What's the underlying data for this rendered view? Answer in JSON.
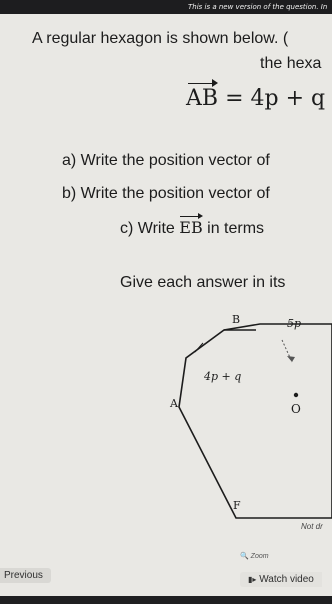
{
  "banner": {
    "text": "This is a new version of the question. In"
  },
  "question": {
    "line1": "A regular hexagon is shown below. (",
    "line2": "the hexa",
    "vector_eq": {
      "lhs": "AB",
      "rhs": "= 4p + q"
    },
    "part_a": "a) Write the position vector of",
    "part_b": "b) Write the position vector of",
    "part_c_prefix": "c) Write",
    "part_c_vec": "EB",
    "part_c_suffix": "in terms",
    "instruction": "Give each answer in its"
  },
  "diagram": {
    "label_B": "B",
    "label_5p": "5p",
    "label_4pq": "4p + q",
    "label_A": "A",
    "label_O": "O",
    "label_F": "F",
    "not_drawn": "Not dr"
  },
  "footer": {
    "zoom_label": "Zoom",
    "previous_label": "Previous",
    "watch_video_label": "Watch video"
  },
  "colors": {
    "banner_bg": "#1d1d1f",
    "page_bg": "#e9e8e4"
  }
}
